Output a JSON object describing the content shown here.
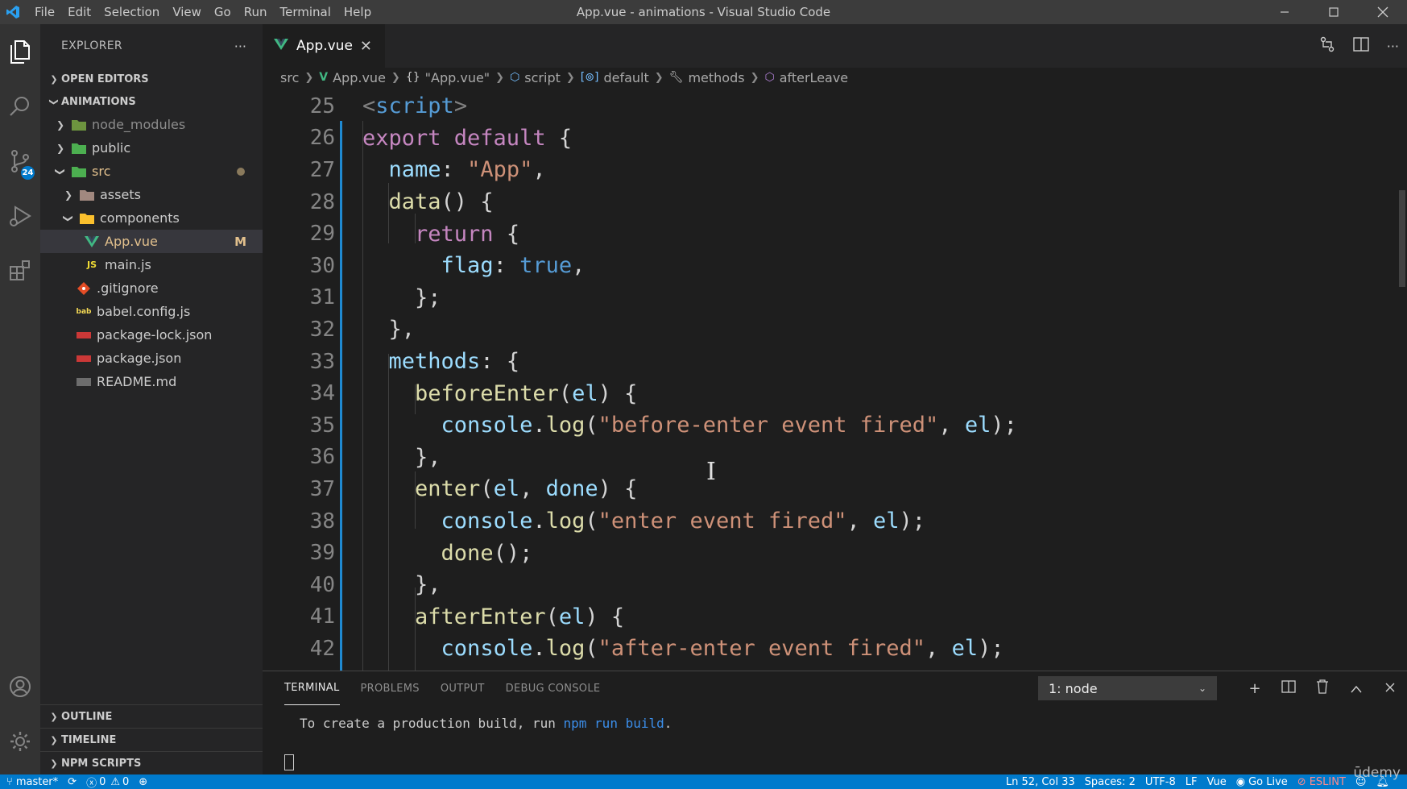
{
  "window": {
    "title": "App.vue - animations - Visual Studio Code",
    "menu": [
      "File",
      "Edit",
      "Selection",
      "View",
      "Go",
      "Run",
      "Terminal",
      "Help"
    ]
  },
  "activity": {
    "scm_badge": "24"
  },
  "sidebar": {
    "title": "EXPLORER",
    "open_editors": "OPEN EDITORS",
    "project": "ANIMATIONS",
    "tree": [
      {
        "label": "node_modules",
        "type": "folder"
      },
      {
        "label": "public",
        "type": "folder"
      },
      {
        "label": "src",
        "type": "folder-open"
      },
      {
        "label": "assets",
        "type": "folder"
      },
      {
        "label": "components",
        "type": "folder-open"
      },
      {
        "label": "App.vue",
        "type": "vue",
        "badge": "M"
      },
      {
        "label": "main.js",
        "type": "js"
      },
      {
        "label": ".gitignore",
        "type": "git"
      },
      {
        "label": "babel.config.js",
        "type": "babel"
      },
      {
        "label": "package-lock.json",
        "type": "npm"
      },
      {
        "label": "package.json",
        "type": "npm"
      },
      {
        "label": "README.md",
        "type": "md"
      }
    ],
    "outline": "OUTLINE",
    "timeline": "TIMELINE",
    "npm_scripts": "NPM SCRIPTS"
  },
  "editor": {
    "tab_label": "App.vue",
    "breadcrumb": [
      "src",
      "App.vue",
      "\"App.vue\"",
      "script",
      "default",
      "methods",
      "afterLeave"
    ],
    "line_numbers": [
      "25",
      "26",
      "27",
      "28",
      "29",
      "30",
      "31",
      "32",
      "33",
      "34",
      "35",
      "36",
      "37",
      "38",
      "39",
      "40",
      "41",
      "42"
    ]
  },
  "panel": {
    "tabs": [
      "TERMINAL",
      "PROBLEMS",
      "OUTPUT",
      "DEBUG CONSOLE"
    ],
    "terminal_select": "1: node",
    "output_prefix": "To create a production build, run ",
    "output_cmd": "npm run build",
    "output_suffix": "."
  },
  "status": {
    "branch": "master*",
    "errors": "0",
    "warnings": "0",
    "position": "Ln 52, Col 33",
    "spaces": "Spaces: 2",
    "encoding": "UTF-8",
    "eol": "LF",
    "language": "Vue",
    "golive": "Go Live",
    "eslint": "ESLINT"
  },
  "watermark": "ūdemy",
  "colors": {
    "accent": "#007acc",
    "keyword": "#c586c0",
    "string": "#ce9178",
    "property": "#9cdcfe",
    "function": "#dcdcaa",
    "tag": "#569cd6"
  }
}
